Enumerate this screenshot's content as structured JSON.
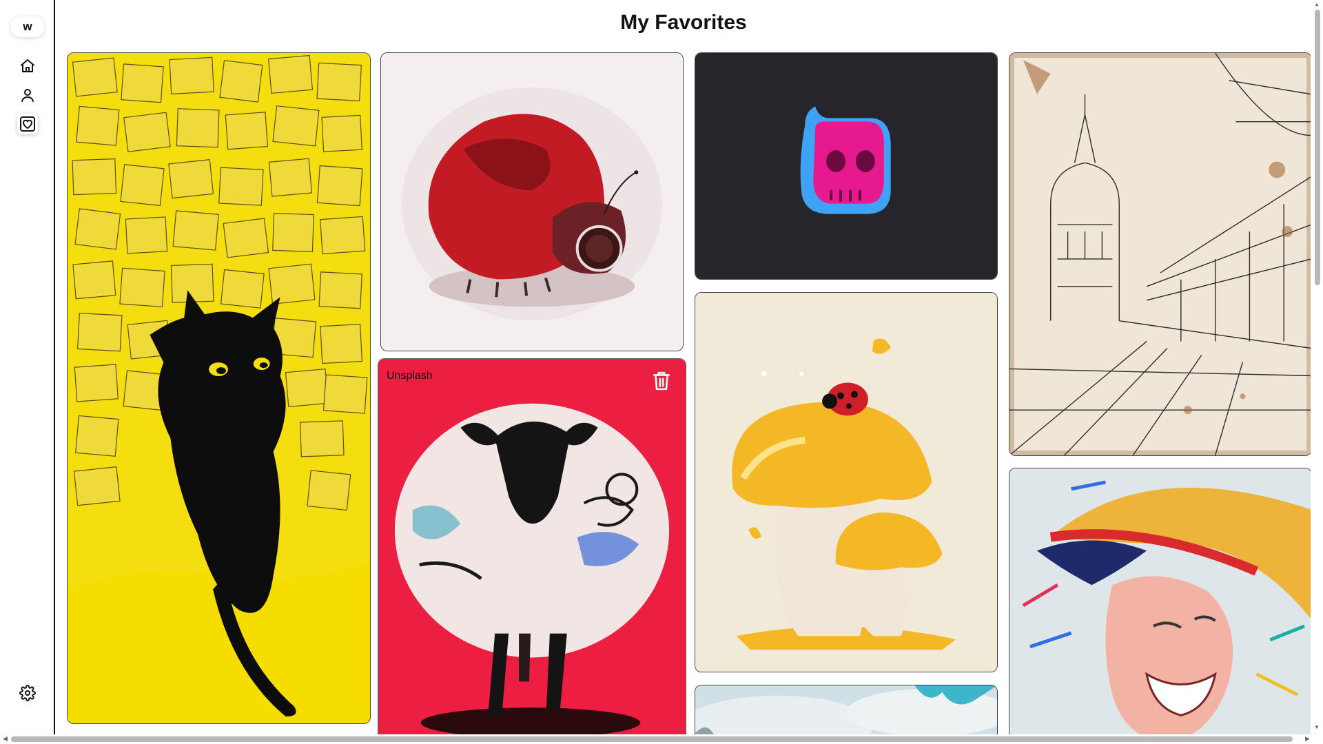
{
  "sidebar": {
    "logo_text": "w",
    "items": [
      {
        "name": "home",
        "icon": "home-icon"
      },
      {
        "name": "profile",
        "icon": "user-icon"
      },
      {
        "name": "favorites",
        "icon": "heart-icon",
        "active": true
      }
    ],
    "settings_icon": "gear-icon"
  },
  "page": {
    "title": "My Favorites"
  },
  "favorites": [
    {
      "id": "black-cat-sticky-notes",
      "theme": "yellow"
    },
    {
      "id": "red-ladybug-painting",
      "theme": "red"
    },
    {
      "id": "pink-skull-slime-icon",
      "theme": "dark"
    },
    {
      "id": "baroque-architecture-sketch",
      "theme": "sepia"
    },
    {
      "id": "graffiti-sheep",
      "theme": "red",
      "source": "Unsplash",
      "hovered": true
    },
    {
      "id": "mushroom-ladybug",
      "theme": "cream"
    },
    {
      "id": "straw-hat-smile",
      "theme": "multicolor"
    },
    {
      "id": "sky-clouds",
      "theme": "blue"
    }
  ],
  "colors": {
    "accent_red": "#EC1F42",
    "yellow": "#F4DE10",
    "dark_card": "#25252B"
  }
}
